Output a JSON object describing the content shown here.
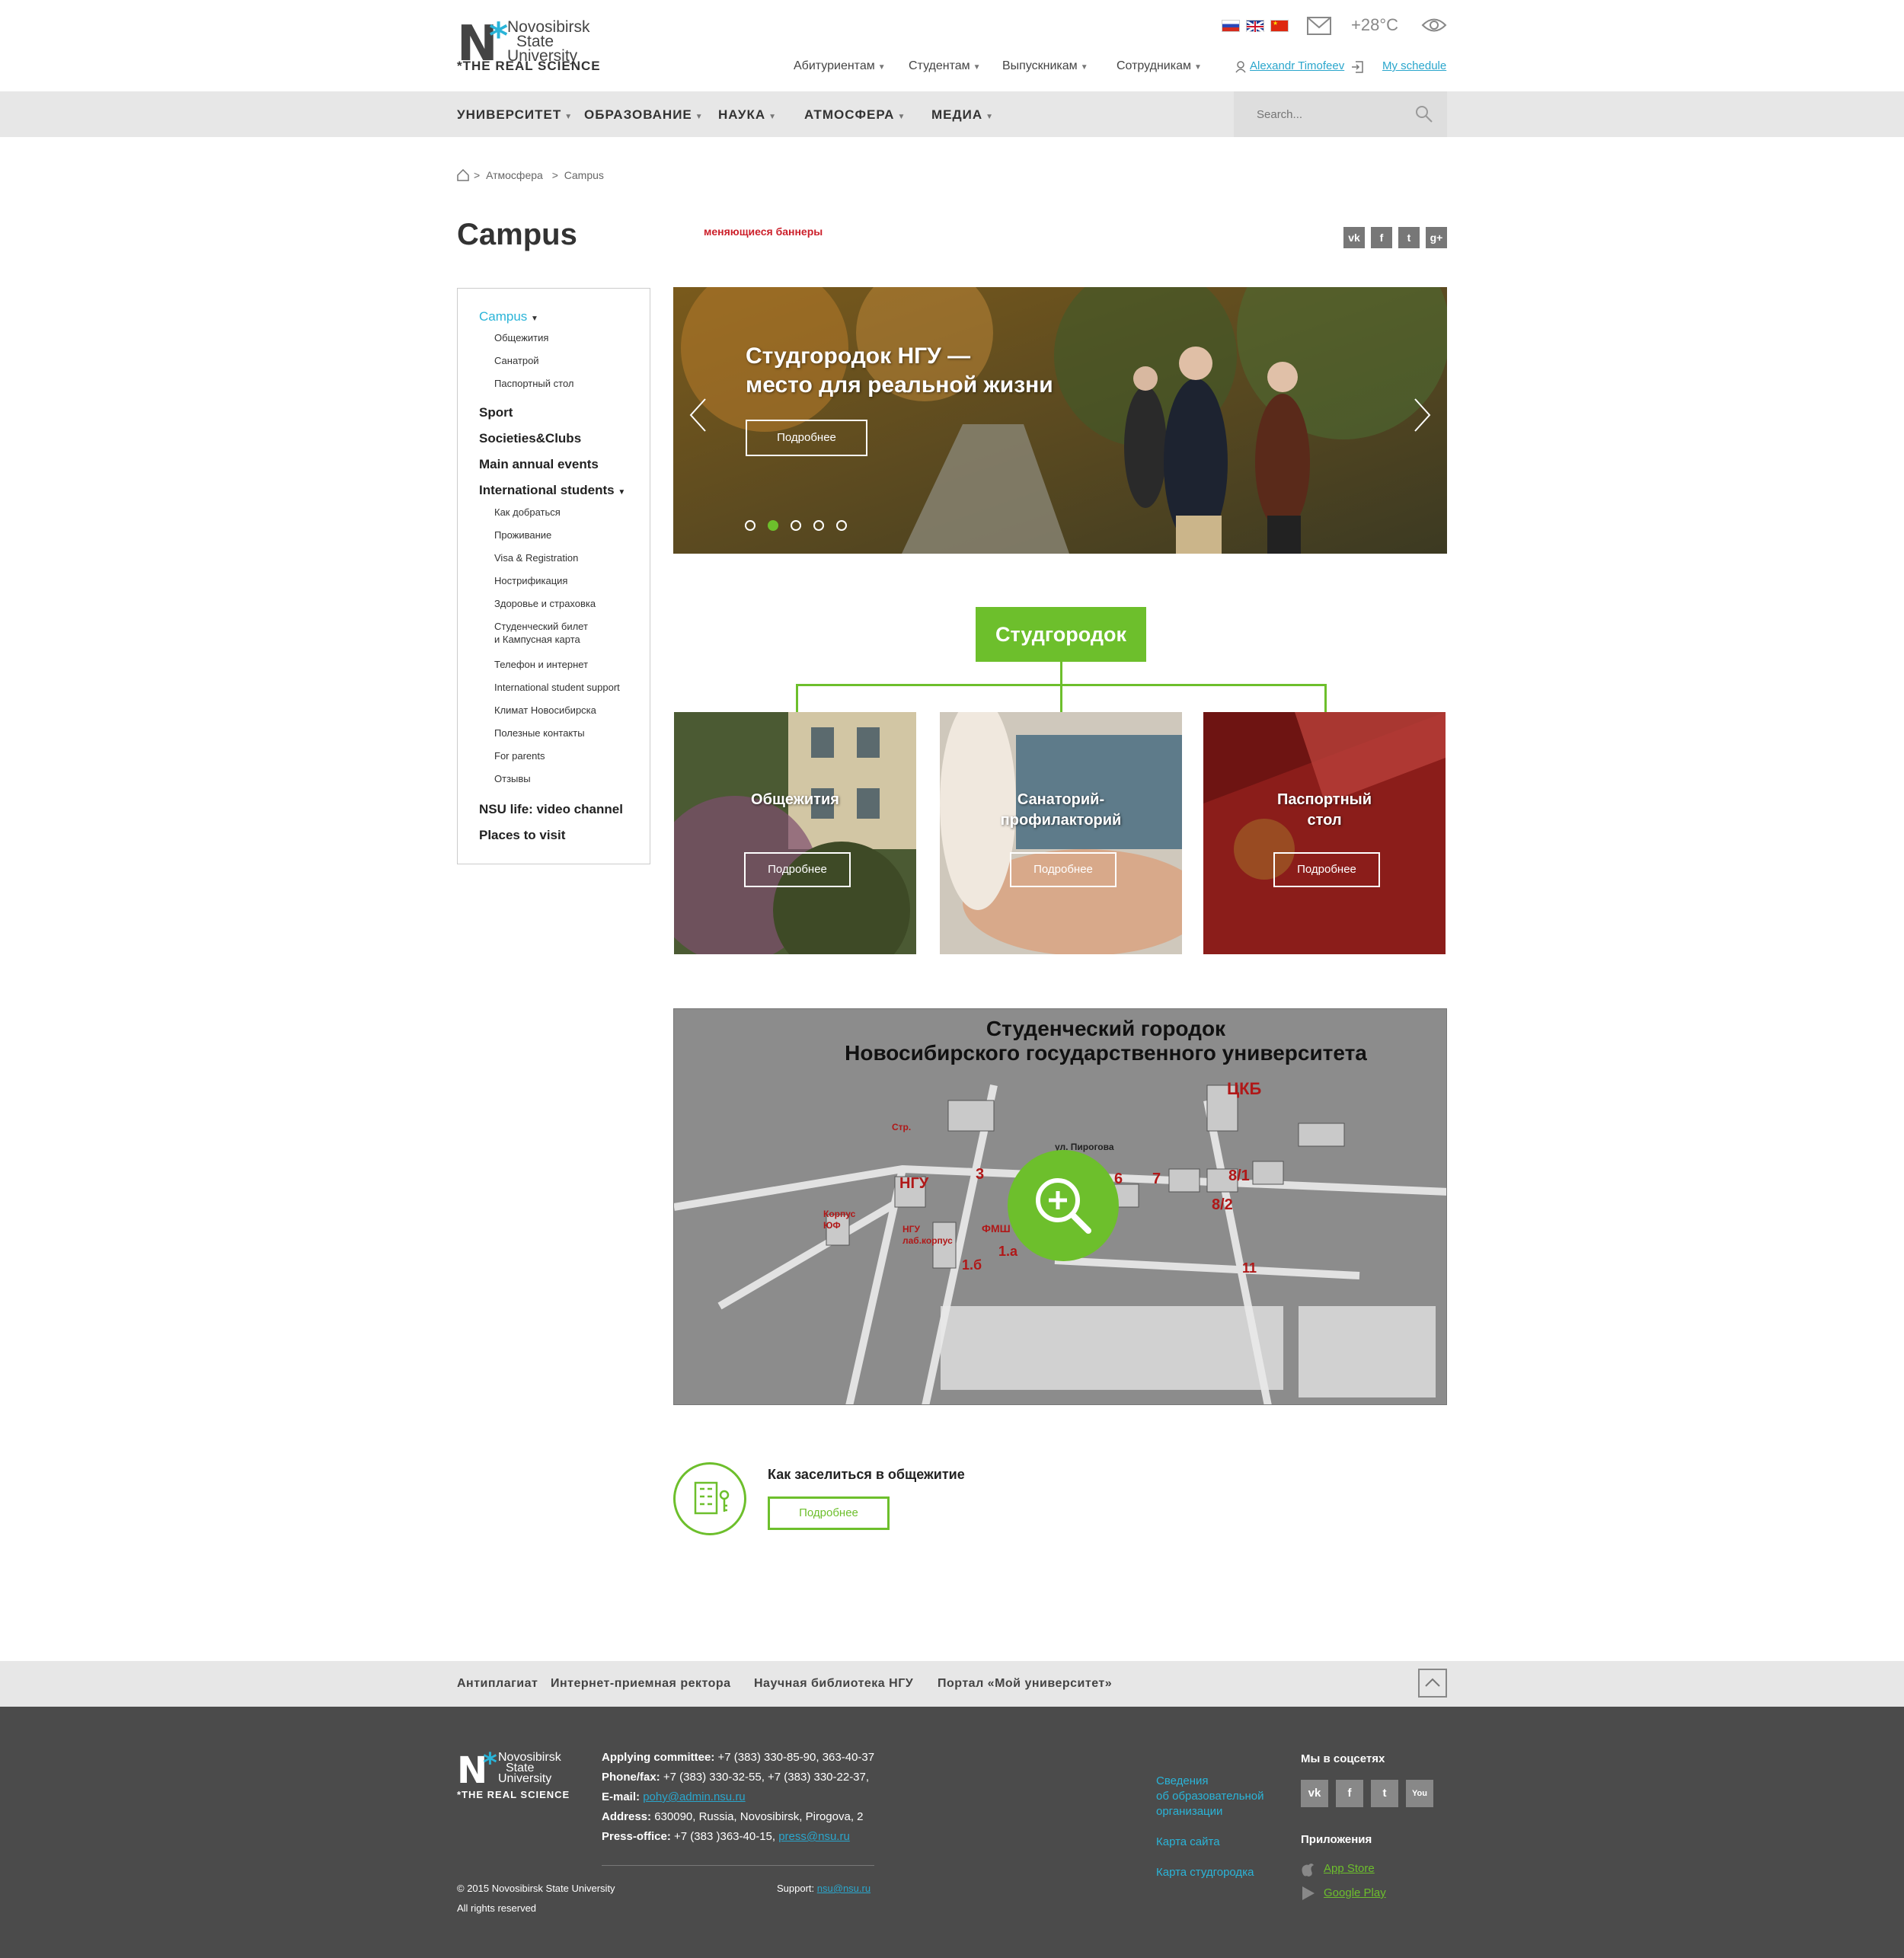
{
  "header": {
    "logo": {
      "letter": "N",
      "star": "*",
      "line1": "Novosibirsk",
      "line2": "State",
      "line3": "University",
      "tagline": "*THE REAL SCIENCE"
    },
    "flags": [
      "ru-flag",
      "uk-flag",
      "cn-flag"
    ],
    "temperature": "+28°C",
    "top_links": [
      "Абитуриентам",
      "Студентам",
      "Выпускникам",
      "Сотрудникам"
    ],
    "user": "Alexandr Timofeev",
    "schedule": "My schedule"
  },
  "nav": {
    "items": [
      "УНИВЕРСИТЕТ",
      "ОБРАЗОВАНИЕ",
      "НАУКА",
      "АТМОСФЕРА",
      "МЕДИА"
    ],
    "search_placeholder": "Search..."
  },
  "breadcrumb": {
    "items": [
      "Атмосфера",
      "Campus"
    ],
    "sep": ">"
  },
  "page": {
    "title": "Campus",
    "note": "меняющиеся баннеры",
    "share": [
      "vk",
      "f",
      "t",
      "g+"
    ]
  },
  "sidebar": {
    "campus": "Campus",
    "campus_sub": [
      "Общежития",
      "Санатрой",
      "Паспортный стол"
    ],
    "sport": "Sport",
    "societies": "Societies&Clubs",
    "events": "Main annual events",
    "intl": "International students",
    "intl_sub": [
      "Как добраться",
      "Проживание",
      "Visa & Registration",
      "Нострификация",
      "Здоровье и страховка",
      "Студенческий билет",
      "и Кампусная карта",
      "Телефон и интернет",
      "International student support",
      "Климат Новосибирска",
      "Полезные контакты",
      "For parents",
      "Отзывы"
    ],
    "video": "NSU life: video channel",
    "places": "Places to visit"
  },
  "hero": {
    "line1": "Студгородок НГУ —",
    "line2": "место для реальной жизни",
    "button": "Подробнее",
    "slides": 5,
    "active_slide": 2
  },
  "tree": {
    "head": "Студгородок",
    "cards": [
      {
        "l1": "Общежития",
        "l2": "",
        "button": "Подробнее"
      },
      {
        "l1": "Санаторий-",
        "l2": "профилакторий",
        "button": "Подробнее"
      },
      {
        "l1": "Паспортный",
        "l2": "стол",
        "button": "Подробнее"
      }
    ]
  },
  "map": {
    "title1": "Студенческий городок",
    "title2": "Новосибирского государственного университета",
    "labels": {
      "ckb": "ЦКБ",
      "ngu": "НГУ",
      "str": "Стр.",
      "korpus": "Корпус",
      "yuf": "ЮФ",
      "ngu_lab": "НГУ",
      "lab": "лаб.корпус",
      "fmsh": "ФМШ",
      "pirogova": "ул. Пирогова",
      "n3": "3",
      "n6": "6",
      "n7": "7",
      "n81": "8/1",
      "n82": "8/2",
      "n11": "11",
      "n16": "1.б",
      "n1a": "1.а"
    }
  },
  "info": {
    "title": "Как заселиться в общежитие",
    "button": "Подробнее"
  },
  "footer_links": [
    "Антиплагиат",
    "Интернет-приемная ректора",
    "Научная библиотека НГУ",
    "Портал «Мой университет»"
  ],
  "footer": {
    "applying_label": "Applying committee:",
    "applying": " +7 (383) 330-85-90, 363-40-37",
    "phone_label": "Phone/fax:",
    "phone": " +7 (383) 330-32-55, +7 (383) 330-22-37,",
    "email_label": "E-mail:",
    "email": "pohy@admin.nsu.ru",
    "address_label": "Address:",
    "address": " 630090, Russia, Novosibirsk, Pirogova, 2",
    "press_label": "Press-office:",
    "press": " +7 (383 )363-40-15, ",
    "press_email": "press@nsu.ru",
    "copyright": "© 2015 Novosibirsk State University",
    "rights": "All rights reserved",
    "support_label": "Support:",
    "support_email": "nsu@nsu.ru",
    "mid_links": [
      "Сведения",
      "об образовательной",
      "организации",
      "Карта сайта",
      "Карта студгородка"
    ],
    "social_title": "Мы в соцсетях",
    "social": [
      "vk",
      "f",
      "t",
      "You"
    ],
    "apps_title": "Приложения",
    "app_store": "App Store",
    "google_play": "Google Play"
  },
  "colors": {
    "accent": "#6dbf2c",
    "link": "#2aa6cc",
    "footer": "#4b4b4b",
    "note": "#cc1f2a"
  }
}
